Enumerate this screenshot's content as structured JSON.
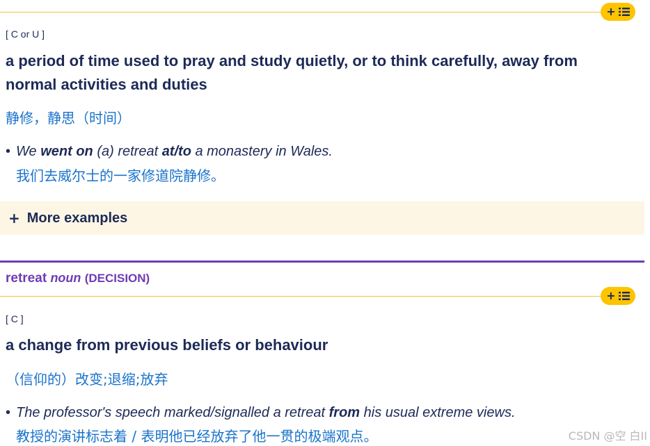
{
  "sense1": {
    "grammar": "[ C or U ]",
    "definition": "a period of time used to pray and study quietly, or to think carefully, away from normal activities and duties",
    "translation": "静修，静思（时间）",
    "example": {
      "bullet": "•",
      "parts": [
        "We ",
        "went on",
        " (a) retreat ",
        "at/to",
        " a monastery in Wales."
      ],
      "translation": "我们去威尔士的一家修道院静修。"
    },
    "more_examples": {
      "icon": "+",
      "label": "More examples"
    }
  },
  "entry2": {
    "headword": "retreat",
    "pos": "noun",
    "guideword": "(DECISION)"
  },
  "sense2": {
    "grammar": "[ C ]",
    "definition": "a change from previous beliefs or behaviour",
    "translation": "（信仰的）改变;退缩;放弃",
    "example": {
      "bullet": "•",
      "parts": [
        "The professor's speech marked/signalled a retreat ",
        "from",
        " his usual extreme views."
      ],
      "translation": "教授的演讲标志着 / 表明他已经放弃了他一贯的极端观点。"
    }
  },
  "add_to_list_button": {
    "plus": "+",
    "icon": "list-icon"
  },
  "watermark": "CSDN @空 白II",
  "colors": {
    "accent_yellow": "#fec400",
    "rule_yellow": "#f3c33b",
    "navy": "#1d2a57",
    "blue_translation": "#1a73cb",
    "purple": "#6f3bb5",
    "more_bg": "#fef6e4"
  }
}
